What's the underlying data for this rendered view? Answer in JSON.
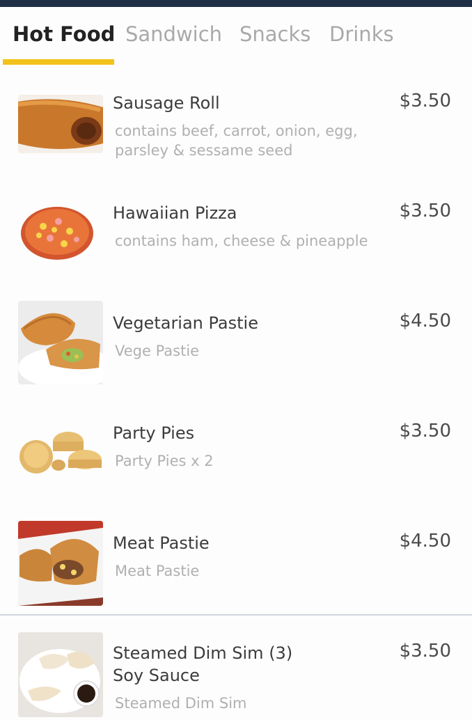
{
  "tabs": [
    {
      "label": "Hot Food",
      "active": true
    },
    {
      "label": "Sandwich",
      "active": false
    },
    {
      "label": "Snacks",
      "active": false
    },
    {
      "label": "Drinks",
      "active": false
    }
  ],
  "items": [
    {
      "name": "Sausage Roll",
      "price": "$3.50",
      "desc": "contains beef, carrot, onion, egg, parsley & sessame seed",
      "icon": "sausage-roll-image"
    },
    {
      "name": "Hawaiian Pizza",
      "price": "$3.50",
      "desc": "contains ham, cheese & pineapple",
      "icon": "pizza-image"
    },
    {
      "name": "Vegetarian Pastie",
      "price": "$4.50",
      "desc": "Vege Pastie",
      "icon": "vegetarian-pastie-image"
    },
    {
      "name": "Party Pies",
      "price": "$3.50",
      "desc": "Party Pies x 2",
      "icon": "party-pies-image"
    },
    {
      "name": "Meat Pastie",
      "price": "$4.50",
      "desc": "Meat Pastie",
      "icon": "meat-pastie-image"
    },
    {
      "name": "Steamed Dim Sim (3)",
      "name2": "Soy Sauce",
      "price": "$3.50",
      "desc": "Steamed Dim Sim",
      "icon": "dim-sim-image"
    }
  ],
  "colors": {
    "accent": "#f2c21b",
    "topbar": "#1f2f45",
    "price": "#4a4a4a",
    "desc": "#b0b0b0"
  }
}
